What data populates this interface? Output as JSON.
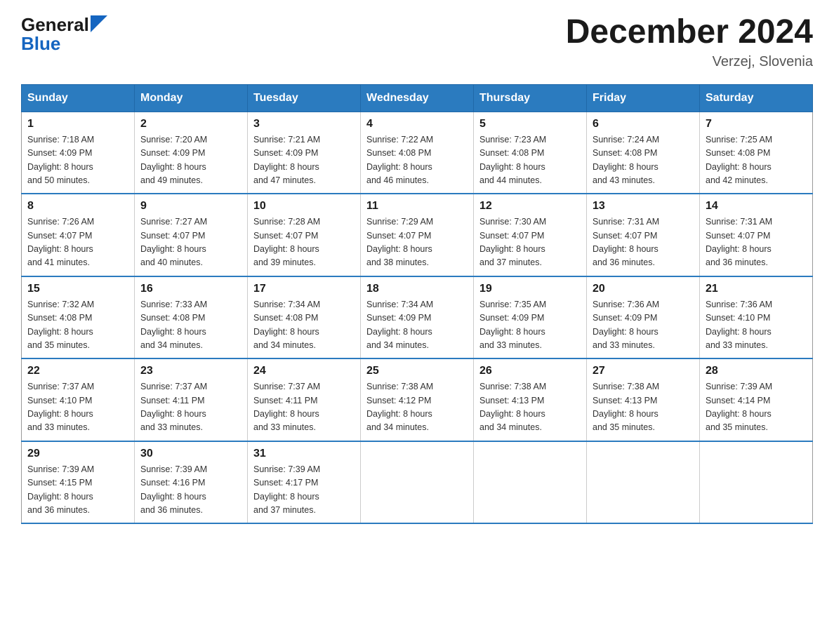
{
  "header": {
    "logo_general": "General",
    "logo_blue": "Blue",
    "month_title": "December 2024",
    "location": "Verzej, Slovenia"
  },
  "weekdays": [
    "Sunday",
    "Monday",
    "Tuesday",
    "Wednesday",
    "Thursday",
    "Friday",
    "Saturday"
  ],
  "weeks": [
    [
      {
        "day": "1",
        "sunrise": "7:18 AM",
        "sunset": "4:09 PM",
        "daylight": "8 hours and 50 minutes."
      },
      {
        "day": "2",
        "sunrise": "7:20 AM",
        "sunset": "4:09 PM",
        "daylight": "8 hours and 49 minutes."
      },
      {
        "day": "3",
        "sunrise": "7:21 AM",
        "sunset": "4:09 PM",
        "daylight": "8 hours and 47 minutes."
      },
      {
        "day": "4",
        "sunrise": "7:22 AM",
        "sunset": "4:08 PM",
        "daylight": "8 hours and 46 minutes."
      },
      {
        "day": "5",
        "sunrise": "7:23 AM",
        "sunset": "4:08 PM",
        "daylight": "8 hours and 44 minutes."
      },
      {
        "day": "6",
        "sunrise": "7:24 AM",
        "sunset": "4:08 PM",
        "daylight": "8 hours and 43 minutes."
      },
      {
        "day": "7",
        "sunrise": "7:25 AM",
        "sunset": "4:08 PM",
        "daylight": "8 hours and 42 minutes."
      }
    ],
    [
      {
        "day": "8",
        "sunrise": "7:26 AM",
        "sunset": "4:07 PM",
        "daylight": "8 hours and 41 minutes."
      },
      {
        "day": "9",
        "sunrise": "7:27 AM",
        "sunset": "4:07 PM",
        "daylight": "8 hours and 40 minutes."
      },
      {
        "day": "10",
        "sunrise": "7:28 AM",
        "sunset": "4:07 PM",
        "daylight": "8 hours and 39 minutes."
      },
      {
        "day": "11",
        "sunrise": "7:29 AM",
        "sunset": "4:07 PM",
        "daylight": "8 hours and 38 minutes."
      },
      {
        "day": "12",
        "sunrise": "7:30 AM",
        "sunset": "4:07 PM",
        "daylight": "8 hours and 37 minutes."
      },
      {
        "day": "13",
        "sunrise": "7:31 AM",
        "sunset": "4:07 PM",
        "daylight": "8 hours and 36 minutes."
      },
      {
        "day": "14",
        "sunrise": "7:31 AM",
        "sunset": "4:07 PM",
        "daylight": "8 hours and 36 minutes."
      }
    ],
    [
      {
        "day": "15",
        "sunrise": "7:32 AM",
        "sunset": "4:08 PM",
        "daylight": "8 hours and 35 minutes."
      },
      {
        "day": "16",
        "sunrise": "7:33 AM",
        "sunset": "4:08 PM",
        "daylight": "8 hours and 34 minutes."
      },
      {
        "day": "17",
        "sunrise": "7:34 AM",
        "sunset": "4:08 PM",
        "daylight": "8 hours and 34 minutes."
      },
      {
        "day": "18",
        "sunrise": "7:34 AM",
        "sunset": "4:09 PM",
        "daylight": "8 hours and 34 minutes."
      },
      {
        "day": "19",
        "sunrise": "7:35 AM",
        "sunset": "4:09 PM",
        "daylight": "8 hours and 33 minutes."
      },
      {
        "day": "20",
        "sunrise": "7:36 AM",
        "sunset": "4:09 PM",
        "daylight": "8 hours and 33 minutes."
      },
      {
        "day": "21",
        "sunrise": "7:36 AM",
        "sunset": "4:10 PM",
        "daylight": "8 hours and 33 minutes."
      }
    ],
    [
      {
        "day": "22",
        "sunrise": "7:37 AM",
        "sunset": "4:10 PM",
        "daylight": "8 hours and 33 minutes."
      },
      {
        "day": "23",
        "sunrise": "7:37 AM",
        "sunset": "4:11 PM",
        "daylight": "8 hours and 33 minutes."
      },
      {
        "day": "24",
        "sunrise": "7:37 AM",
        "sunset": "4:11 PM",
        "daylight": "8 hours and 33 minutes."
      },
      {
        "day": "25",
        "sunrise": "7:38 AM",
        "sunset": "4:12 PM",
        "daylight": "8 hours and 34 minutes."
      },
      {
        "day": "26",
        "sunrise": "7:38 AM",
        "sunset": "4:13 PM",
        "daylight": "8 hours and 34 minutes."
      },
      {
        "day": "27",
        "sunrise": "7:38 AM",
        "sunset": "4:13 PM",
        "daylight": "8 hours and 35 minutes."
      },
      {
        "day": "28",
        "sunrise": "7:39 AM",
        "sunset": "4:14 PM",
        "daylight": "8 hours and 35 minutes."
      }
    ],
    [
      {
        "day": "29",
        "sunrise": "7:39 AM",
        "sunset": "4:15 PM",
        "daylight": "8 hours and 36 minutes."
      },
      {
        "day": "30",
        "sunrise": "7:39 AM",
        "sunset": "4:16 PM",
        "daylight": "8 hours and 36 minutes."
      },
      {
        "day": "31",
        "sunrise": "7:39 AM",
        "sunset": "4:17 PM",
        "daylight": "8 hours and 37 minutes."
      },
      null,
      null,
      null,
      null
    ]
  ],
  "labels": {
    "sunrise": "Sunrise:",
    "sunset": "Sunset:",
    "daylight": "Daylight:"
  }
}
